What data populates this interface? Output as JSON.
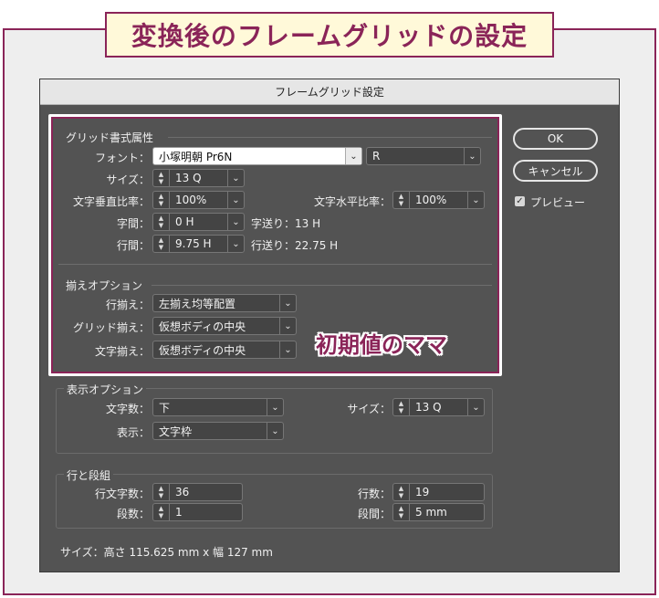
{
  "banner": {
    "text": "変換後のフレームグリッドの設定"
  },
  "dialog": {
    "title": "フレームグリッド設定",
    "grid_attrs": {
      "group_label": "グリッド書式属性",
      "font_label": "フォント：",
      "font_value": "小塚明朝 Pr6N",
      "font_style": "R",
      "size_label": "サイズ：",
      "size_value": "13 Q",
      "vscale_label": "文字垂直比率：",
      "vscale_value": "100%",
      "hscale_label": "文字水平比率：",
      "hscale_value": "100%",
      "tracking_label": "字間：",
      "tracking_value": "0 H",
      "char_advance": "字送り：13 H",
      "leading_label": "行間：",
      "leading_value": "9.75 H",
      "line_advance": "行送り：22.75 H"
    },
    "alignment": {
      "group_label": "揃えオプション",
      "line_align_label": "行揃え：",
      "line_align_value": "左揃え均等配置",
      "grid_align_label": "グリッド揃え：",
      "grid_align_value": "仮想ボディの中央",
      "char_align_label": "文字揃え：",
      "char_align_value": "仮想ボディの中央"
    },
    "view": {
      "group_label": "表示オプション",
      "char_count_label": "文字数：",
      "char_count_value": "下",
      "size_label": "サイズ：",
      "size_value": "13 Q",
      "display_label": "表示：",
      "display_value": "文字枠"
    },
    "rows_cols": {
      "group_label": "行と段組",
      "chars_per_line_label": "行文字数：",
      "chars_per_line_value": "36",
      "lines_label": "行数：",
      "lines_value": "19",
      "columns_label": "段数：",
      "columns_value": "1",
      "gutter_label": "段間：",
      "gutter_value": "5 mm"
    },
    "size_summary": "サイズ：高さ 115.625 mm x 幅 127 mm",
    "buttons": {
      "ok": "OK",
      "cancel": "キャンセル",
      "preview": "プレビュー"
    }
  },
  "annotation": {
    "text": "初期値のママ"
  },
  "colors": {
    "accent": "#8a2458",
    "dialog_bg": "#535353",
    "banner_bg": "#fff9d9"
  }
}
